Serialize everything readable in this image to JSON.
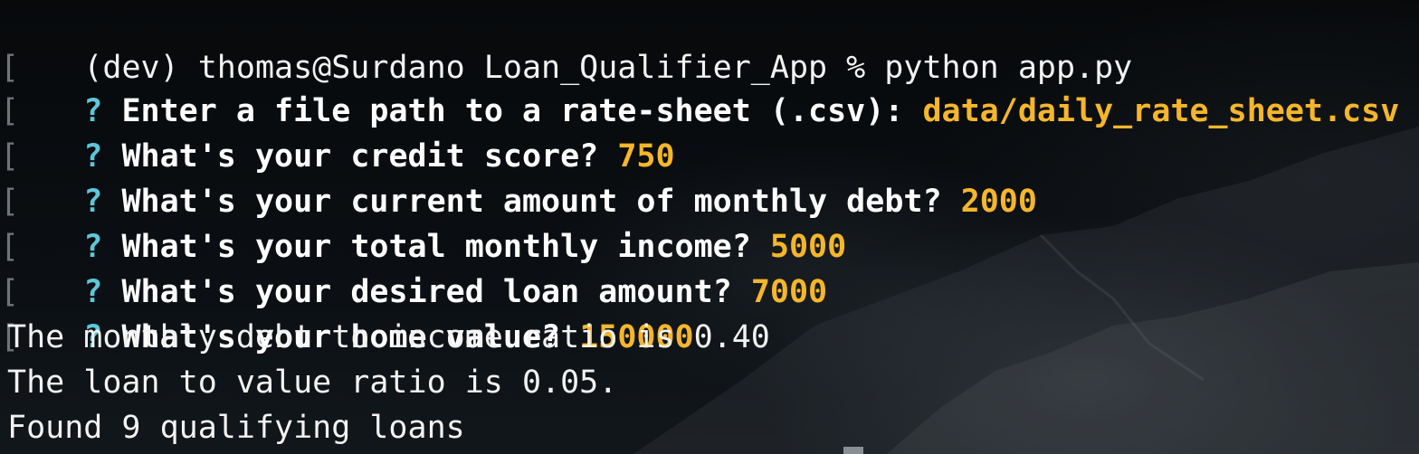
{
  "terminal": {
    "command_line": "(dev) thomas@Surdano Loan_Qualifier_App % python app.py",
    "bracket_glyph": "[",
    "question_mark": "?",
    "questions": [
      {
        "prompt": "Enter a file path to a rate-sheet (.csv): ",
        "answer": "data/daily_rate_sheet.csv"
      },
      {
        "prompt": "What's your credit score? ",
        "answer": "750"
      },
      {
        "prompt": "What's your current amount of monthly debt? ",
        "answer": "2000"
      },
      {
        "prompt": "What's your total monthly income? ",
        "answer": "5000"
      },
      {
        "prompt": "What's your desired loan amount? ",
        "answer": "7000"
      },
      {
        "prompt": "What's your home value? ",
        "answer": "150000"
      }
    ],
    "outputs": [
      "The monthly debt to income ratio is 0.40",
      "The loan to value ratio is 0.05.",
      "Found 9 qualifying loans"
    ]
  },
  "colors": {
    "question_mark": "#5ec6d8",
    "answer": "#f5b62a",
    "text": "#ffffff",
    "bracket": "#6f7479"
  }
}
